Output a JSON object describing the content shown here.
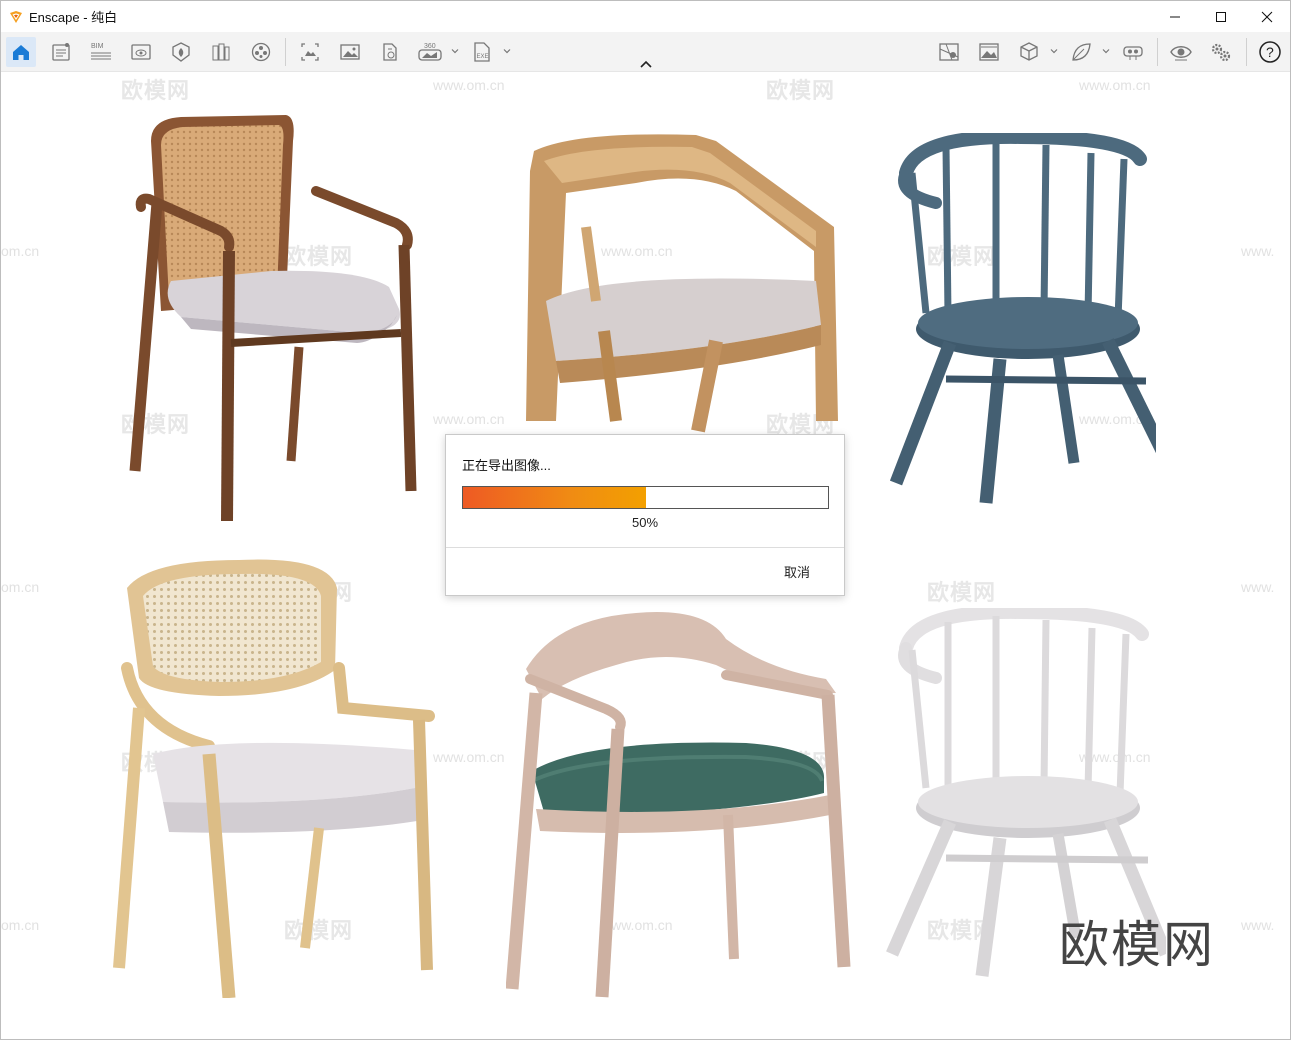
{
  "window": {
    "app_name": "Enscape",
    "title": "Enscape - 纯白"
  },
  "toolbar": {
    "left_icons": [
      "home-icon",
      "notes-icon",
      "bim-icon",
      "view-icon",
      "asset-icon",
      "library-icon",
      "materials-icon",
      "batch-render-icon",
      "screenshot-icon",
      "panorama-icon",
      "export-360-icon",
      "exe-export-icon"
    ],
    "bim_label": "BIM",
    "pano_label": "360",
    "exe_label": "EXE",
    "right_icons": [
      "map-icon",
      "landscape-icon",
      "cube-icon",
      "leaf-icon",
      "vr-headset-icon",
      "eye-icon",
      "settings-icon",
      "help-icon"
    ],
    "help_label": "?"
  },
  "scene": {
    "watermark_brand": "欧模网",
    "watermark_url": "www.om.cn",
    "watermark_url_cut": "om.cn",
    "watermark_url_start": "www."
  },
  "dialog": {
    "title": "正在导出图像...",
    "progress": 0.5,
    "progress_label": "50%",
    "cancel_label": "取消"
  },
  "colors": {
    "accent": "#1a7bd6",
    "progress_start": "#ee5a24",
    "progress_end": "#f3a000"
  }
}
